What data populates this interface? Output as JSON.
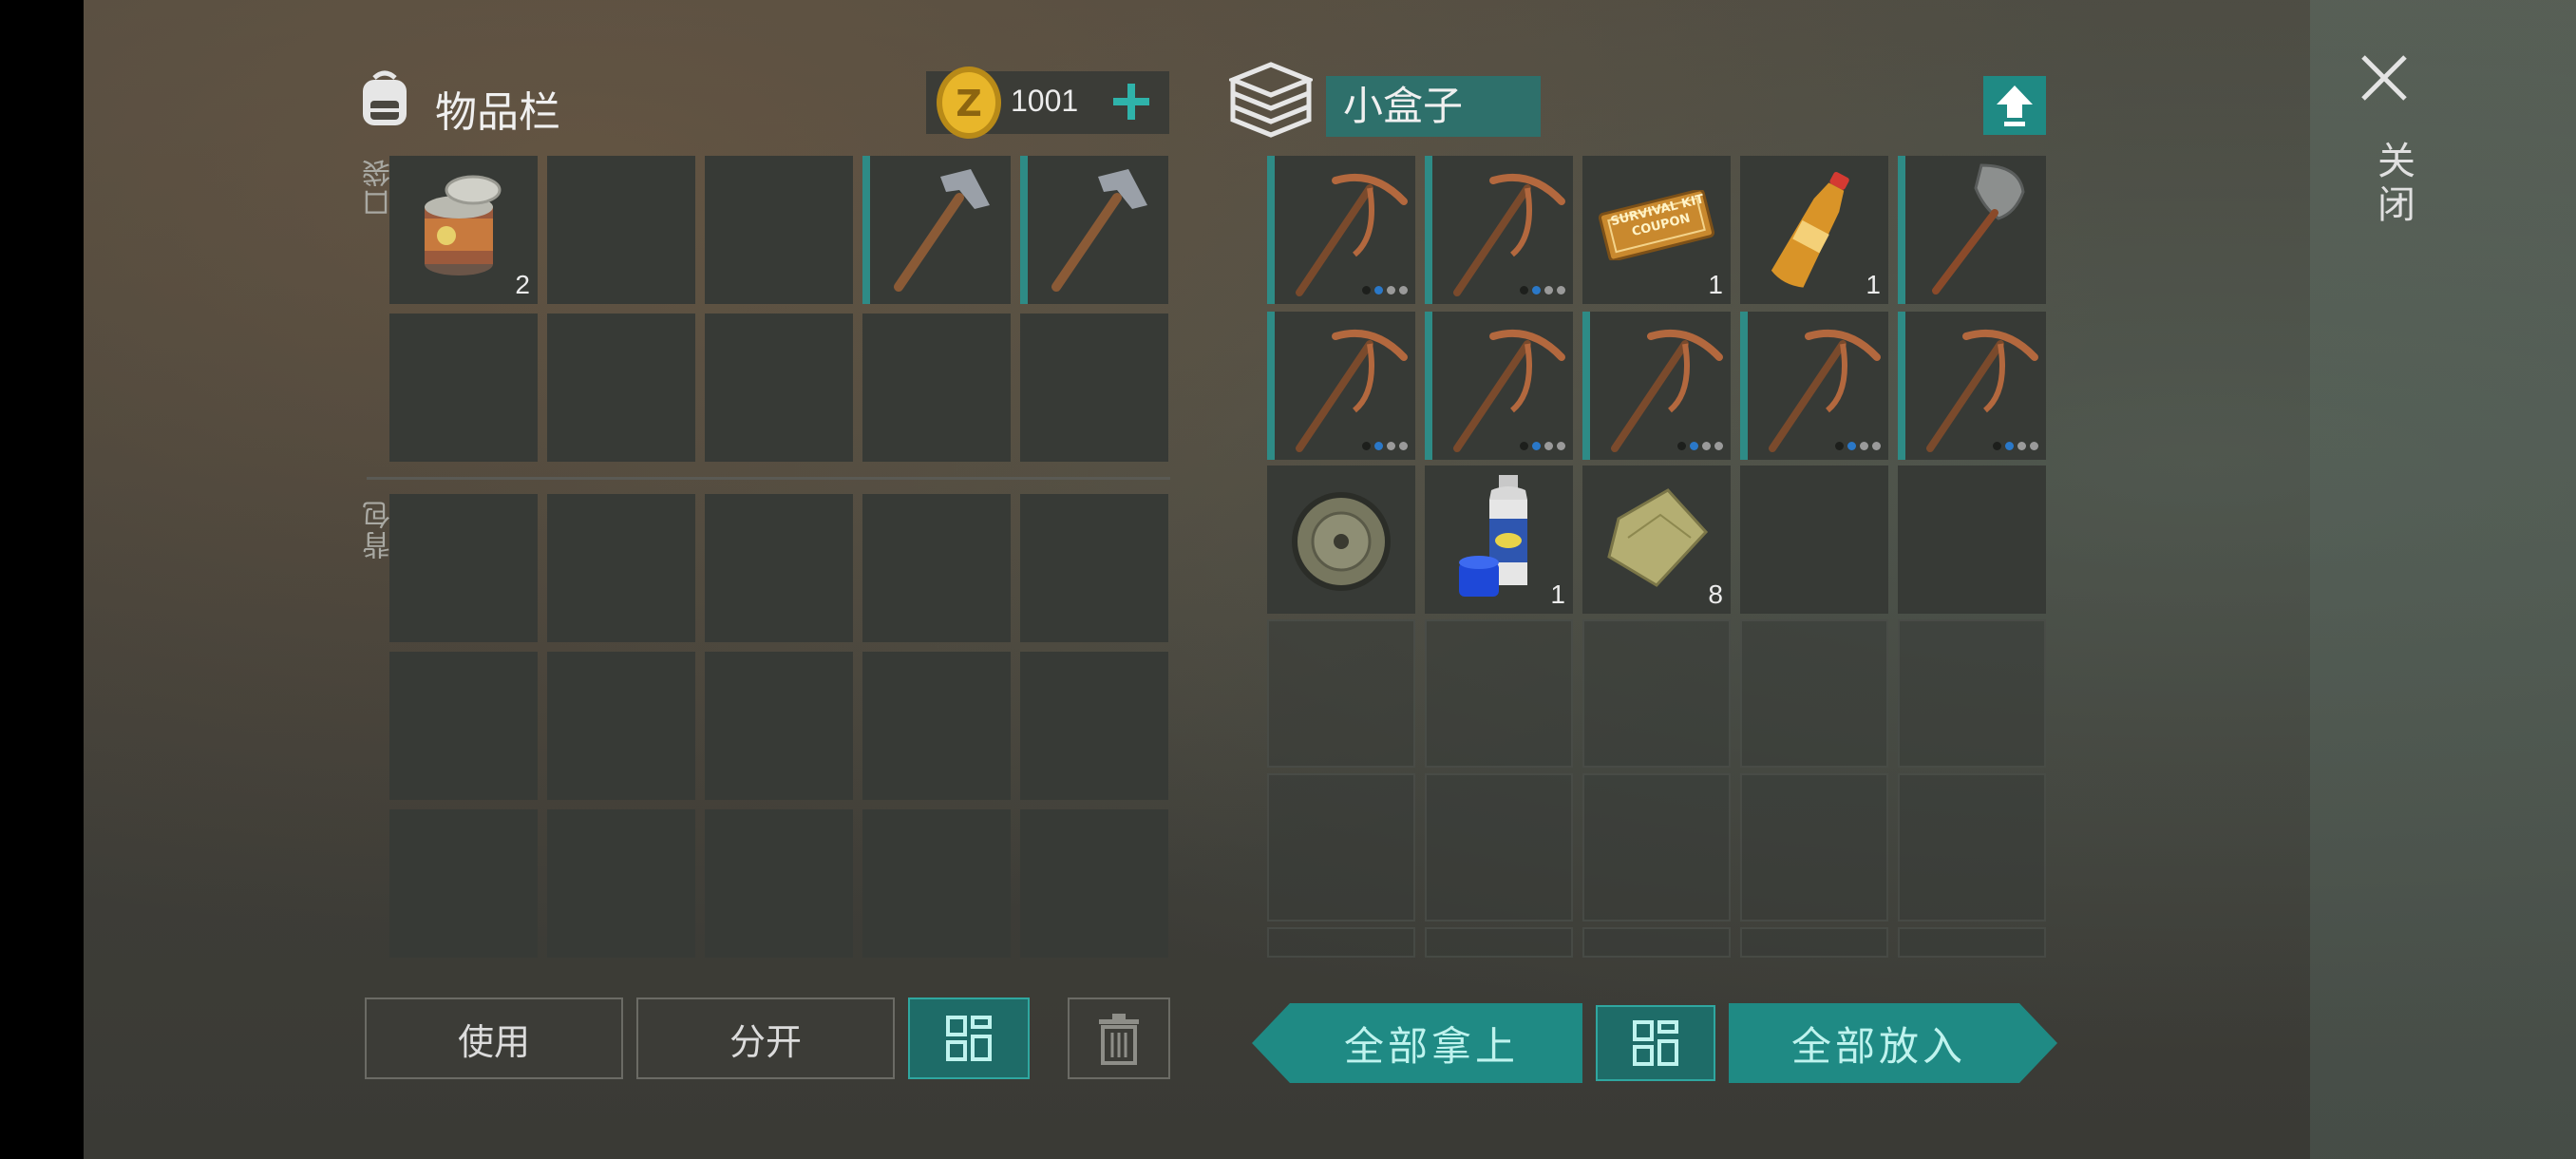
{
  "inventory": {
    "title": "物品栏",
    "coins": "1001",
    "pocket_label": "口袋",
    "backpack_label": "背包",
    "pocket_slots": [
      {
        "item": "canned-food",
        "qty": "2"
      },
      {
        "item": "",
        "qty": ""
      },
      {
        "item": "",
        "qty": ""
      },
      {
        "item": "hammer",
        "qty": ""
      },
      {
        "item": "hammer",
        "qty": ""
      }
    ]
  },
  "container": {
    "name": "小盒子",
    "items": [
      {
        "item": "pickaxe",
        "qty": "",
        "durability": "2/4"
      },
      {
        "item": "pickaxe",
        "qty": "",
        "durability": "2/4"
      },
      {
        "item": "survival-kit-coupon",
        "qty": "1",
        "label": "SURVIVAL KIT COUPON"
      },
      {
        "item": "bottle",
        "qty": "1"
      },
      {
        "item": "shovel",
        "qty": ""
      },
      {
        "item": "pickaxe",
        "qty": "",
        "durability": "2/4"
      },
      {
        "item": "pickaxe",
        "qty": "",
        "durability": "2/4"
      },
      {
        "item": "pickaxe",
        "qty": "",
        "durability": "2/4"
      },
      {
        "item": "pickaxe",
        "qty": "",
        "durability": "2/4"
      },
      {
        "item": "pickaxe",
        "qty": "",
        "durability": "2/4"
      },
      {
        "item": "tire",
        "qty": ""
      },
      {
        "item": "spray-paint",
        "qty": "1"
      },
      {
        "item": "cloth",
        "qty": "8"
      }
    ]
  },
  "buttons": {
    "use": "使用",
    "split": "分开",
    "take_all": "全部拿上",
    "put_all": "全部放入",
    "close": "关闭"
  },
  "colors": {
    "accent": "#2e8b86",
    "button_teal": "#1f8a84",
    "slot": "#373a36"
  },
  "icons": [
    "backpack-icon",
    "coin-icon",
    "plus-icon",
    "box-icon",
    "upload-icon",
    "close-icon",
    "sort-grid-icon",
    "trash-icon"
  ]
}
